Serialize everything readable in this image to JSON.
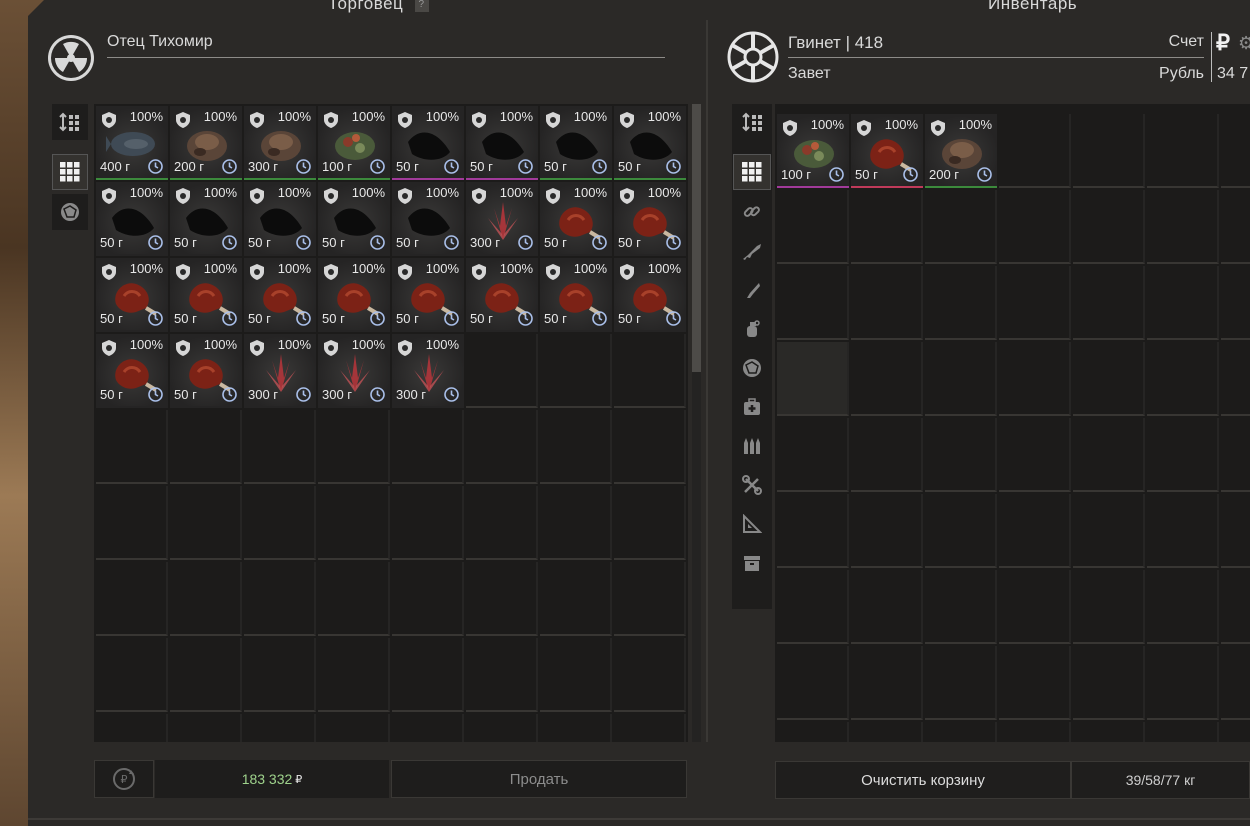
{
  "trader_panel": {
    "title": "Торговец",
    "help_label": "?",
    "trader_name": "Отец Тихомир",
    "money_value": "183 332",
    "money_currency": "₽",
    "sell_label": "Продать",
    "tabs": [
      {
        "icon": "sort-icon",
        "active": false
      },
      {
        "icon": "grid-icon",
        "active": true
      },
      {
        "icon": "artifact-icon",
        "active": false
      }
    ],
    "items": [
      {
        "condition": "100%",
        "weight": "400 г",
        "art": "fish",
        "rarity": "#3c8a3c"
      },
      {
        "condition": "100%",
        "weight": "200 г",
        "art": "chicken",
        "rarity": "#3c8a3c"
      },
      {
        "condition": "100%",
        "weight": "300 г",
        "art": "chicken",
        "rarity": "#3c8a3c"
      },
      {
        "condition": "100%",
        "weight": "100 г",
        "art": "salad",
        "rarity": "#3c8a3c"
      },
      {
        "condition": "100%",
        "weight": "50 г",
        "art": "dark",
        "rarity": "#a13a9a"
      },
      {
        "condition": "100%",
        "weight": "50 г",
        "art": "dark",
        "rarity": "#a13a9a"
      },
      {
        "condition": "100%",
        "weight": "50 г",
        "art": "dark",
        "rarity": "#3c8a3c"
      },
      {
        "condition": "100%",
        "weight": "50 г",
        "art": "dark",
        "rarity": "#3c8a3c"
      },
      {
        "condition": "100%",
        "weight": "50 г",
        "art": "dark",
        "rarity": "none"
      },
      {
        "condition": "100%",
        "weight": "50 г",
        "art": "dark",
        "rarity": "none"
      },
      {
        "condition": "100%",
        "weight": "50 г",
        "art": "dark",
        "rarity": "none"
      },
      {
        "condition": "100%",
        "weight": "50 г",
        "art": "dark",
        "rarity": "none"
      },
      {
        "condition": "100%",
        "weight": "50 г",
        "art": "dark",
        "rarity": "none"
      },
      {
        "condition": "100%",
        "weight": "300 г",
        "art": "crystal",
        "rarity": "none"
      },
      {
        "condition": "100%",
        "weight": "50 г",
        "art": "meat",
        "rarity": "none"
      },
      {
        "condition": "100%",
        "weight": "50 г",
        "art": "meat",
        "rarity": "none"
      },
      {
        "condition": "100%",
        "weight": "50 г",
        "art": "meat",
        "rarity": "none"
      },
      {
        "condition": "100%",
        "weight": "50 г",
        "art": "meat",
        "rarity": "none"
      },
      {
        "condition": "100%",
        "weight": "50 г",
        "art": "meat",
        "rarity": "none"
      },
      {
        "condition": "100%",
        "weight": "50 г",
        "art": "meat",
        "rarity": "none"
      },
      {
        "condition": "100%",
        "weight": "50 г",
        "art": "meat",
        "rarity": "none"
      },
      {
        "condition": "100%",
        "weight": "50 г",
        "art": "meat",
        "rarity": "none"
      },
      {
        "condition": "100%",
        "weight": "50 г",
        "art": "meat",
        "rarity": "none"
      },
      {
        "condition": "100%",
        "weight": "50 г",
        "art": "meat",
        "rarity": "none"
      },
      {
        "condition": "100%",
        "weight": "50 г",
        "art": "meat",
        "rarity": "none"
      },
      {
        "condition": "100%",
        "weight": "50 г",
        "art": "meat",
        "rarity": "none"
      },
      {
        "condition": "100%",
        "weight": "300 г",
        "art": "crystal",
        "rarity": "none"
      },
      {
        "condition": "100%",
        "weight": "300 г",
        "art": "crystal",
        "rarity": "none"
      },
      {
        "condition": "100%",
        "weight": "300 г",
        "art": "crystal",
        "rarity": "none"
      }
    ]
  },
  "inventory_panel": {
    "title": "Инвентарь",
    "player_name": "Гвинет | 418",
    "faction": "Завет",
    "account_label": "Счет",
    "currency_label": "Рубль",
    "currency_sign": "₽",
    "balance": "34 7",
    "clear_cart_label": "Очистить корзину",
    "weight": "39/58/77 кг",
    "tabs": [
      {
        "icon": "sort-icon",
        "active": false
      },
      {
        "icon": "grid-icon",
        "active": true
      },
      {
        "icon": "link-icon",
        "active": false
      },
      {
        "icon": "rifle-icon",
        "active": false
      },
      {
        "icon": "knife-icon",
        "active": false
      },
      {
        "icon": "grenade-icon",
        "active": false
      },
      {
        "icon": "artifact-icon",
        "active": false
      },
      {
        "icon": "medkit-icon",
        "active": false
      },
      {
        "icon": "ammo-icon",
        "active": false
      },
      {
        "icon": "tools-icon",
        "active": false
      },
      {
        "icon": "blueprint-icon",
        "active": false
      },
      {
        "icon": "storage-icon",
        "active": false
      }
    ],
    "items": [
      {
        "condition": "100%",
        "weight": "100 г",
        "art": "salad",
        "rarity": "#a13a9a"
      },
      {
        "condition": "100%",
        "weight": "50 г",
        "art": "meat",
        "rarity": "#c03a5a"
      },
      {
        "condition": "100%",
        "weight": "200 г",
        "art": "chicken",
        "rarity": "#3c8a3c"
      }
    ]
  },
  "colors": {
    "money_green": "#9fd38c",
    "meat_red": "#8a2a1e",
    "crystal_red": "#c0444a"
  }
}
